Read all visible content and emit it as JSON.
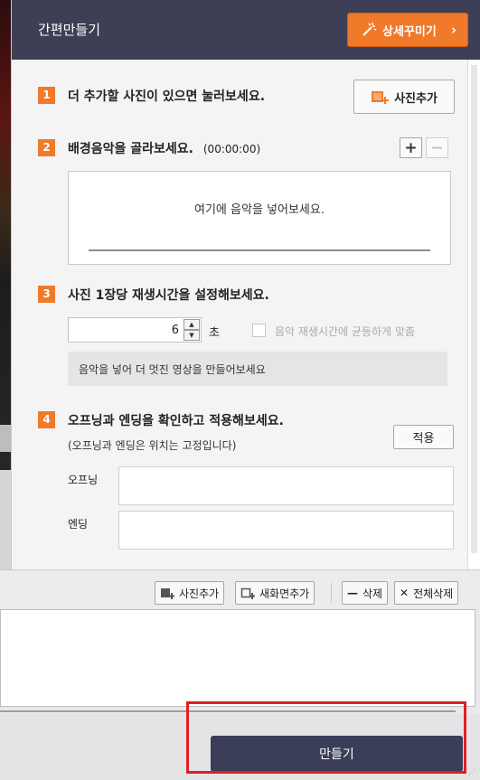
{
  "header": {
    "title": "간편만들기",
    "decorate_button": "상세꾸미기",
    "decorate_chevron": "›"
  },
  "steps": [
    {
      "num": "1",
      "title": "더 추가할 사진이 있으면 눌러보세요.",
      "button": "사진추가"
    },
    {
      "num": "2",
      "title": "배경음악을 골라보세요.",
      "duration": "(00:00:00)",
      "add": "+",
      "remove": "−",
      "placeholder": "여기에 음악을 넣어보세요."
    },
    {
      "num": "3",
      "title": "사진 1장당 재생시간을 설정해보세요.",
      "seconds_value": "6",
      "unit": "초",
      "sync_label": "음악 재생시간에 균등하게 맞춤",
      "info": "음악을 넣어 더 멋진 영상을 만들어보세요"
    },
    {
      "num": "4",
      "title": "오프닝과 엔딩을 확인하고 적용해보세요.",
      "note": "(오프닝과 엔딩은 위치는 고정입니다)",
      "apply": "적용",
      "opening_label": "오프닝",
      "ending_label": "엔딩"
    }
  ],
  "toolbar": {
    "add_photo": "사진추가",
    "add_new_screen": "새화면추가",
    "delete": "삭제",
    "delete_all": "전체삭제"
  },
  "footer": {
    "make_button": "만들기"
  },
  "colors": {
    "header_bg": "#3d3f56",
    "accent_orange": "#f07a2a",
    "make_button_bg": "#3b3e58",
    "highlight_red": "#e02020"
  },
  "icons": [
    "magic-wand-icon",
    "add-photo-icon",
    "add-screen-icon",
    "minus-icon",
    "close-icon"
  ]
}
